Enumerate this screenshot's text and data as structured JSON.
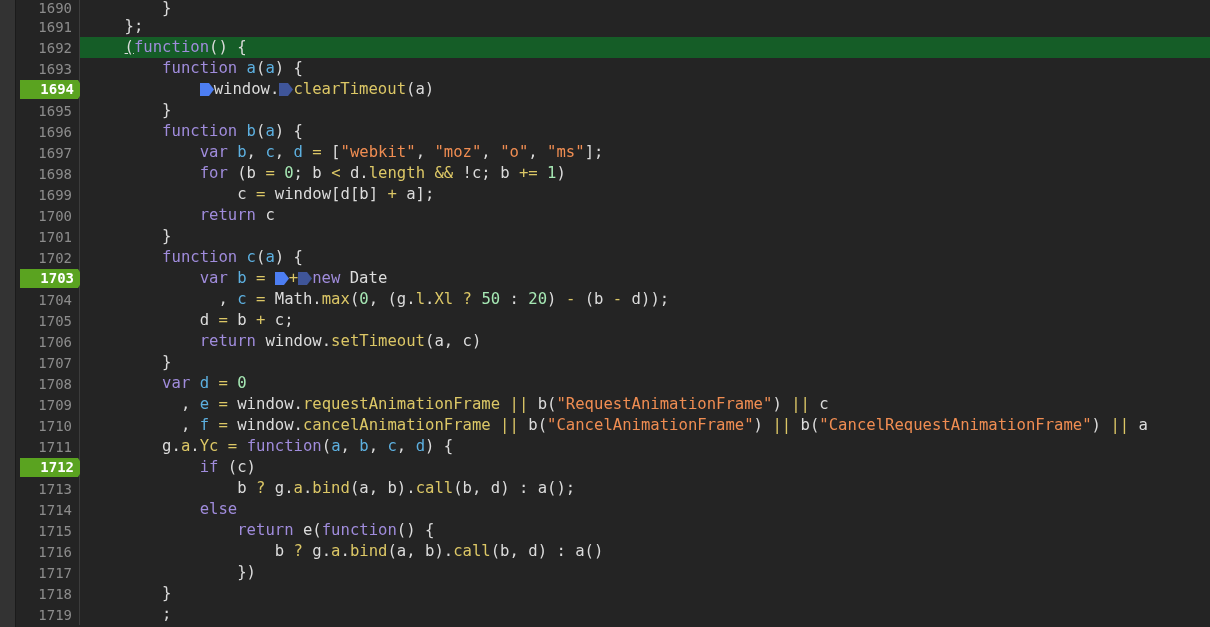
{
  "editor": {
    "lines": [
      {
        "number": "1690",
        "breakpoint": false,
        "current": false,
        "tokens": [
          {
            "text": "        }",
            "kind": "text"
          }
        ]
      },
      {
        "number": "1691",
        "breakpoint": false,
        "current": false,
        "tokens": [
          {
            "text": "    };",
            "kind": "text"
          }
        ]
      },
      {
        "number": "1692",
        "breakpoint": false,
        "current": true,
        "tokens": [
          {
            "text": "    (",
            "kind": "cursor"
          },
          {
            "text": "function",
            "kind": "keyword"
          },
          {
            "text": "() {",
            "kind": "text"
          }
        ]
      },
      {
        "number": "1693",
        "breakpoint": false,
        "current": false,
        "tokens": [
          {
            "text": "        function ",
            "kind": "keyword"
          },
          {
            "text": "a",
            "kind": "param"
          },
          {
            "text": "(",
            "kind": "text"
          },
          {
            "text": "a",
            "kind": "param"
          },
          {
            "text": ") {",
            "kind": "text"
          }
        ]
      },
      {
        "number": "1694",
        "breakpoint": true,
        "current": false,
        "tokens": [
          {
            "kind": "marker",
            "active": true
          },
          {
            "text": "window.",
            "kind": "text"
          },
          {
            "kind": "marker",
            "active": false
          },
          {
            "text": "clearTimeout",
            "kind": "member"
          },
          {
            "text": "(a)",
            "kind": "text"
          }
        ]
      },
      {
        "number": "1695",
        "breakpoint": false,
        "current": false,
        "tokens": [
          {
            "text": "        }",
            "kind": "text"
          }
        ]
      },
      {
        "number": "1696",
        "breakpoint": false,
        "current": false,
        "tokens": [
          {
            "text": "        function ",
            "kind": "keyword"
          },
          {
            "text": "b",
            "kind": "param"
          },
          {
            "text": "(",
            "kind": "text"
          },
          {
            "text": "a",
            "kind": "param"
          },
          {
            "text": ") {",
            "kind": "text"
          }
        ]
      },
      {
        "number": "1697",
        "breakpoint": false,
        "current": false,
        "tokens": [
          {
            "text": "            var ",
            "kind": "keyword"
          },
          {
            "text": "b",
            "kind": "param"
          },
          {
            "text": ", ",
            "kind": "text"
          },
          {
            "text": "c",
            "kind": "param"
          },
          {
            "text": ", ",
            "kind": "text"
          },
          {
            "text": "d ",
            "kind": "param"
          },
          {
            "text": "=",
            "kind": "operator"
          },
          {
            "text": " [",
            "kind": "text"
          },
          {
            "text": "\"webkit\"",
            "kind": "string"
          },
          {
            "text": ", ",
            "kind": "text"
          },
          {
            "text": "\"moz\"",
            "kind": "string"
          },
          {
            "text": ", ",
            "kind": "text"
          },
          {
            "text": "\"o\"",
            "kind": "string"
          },
          {
            "text": ", ",
            "kind": "text"
          },
          {
            "text": "\"ms\"",
            "kind": "string"
          },
          {
            "text": "];",
            "kind": "text"
          }
        ]
      },
      {
        "number": "1698",
        "breakpoint": false,
        "current": false,
        "tokens": [
          {
            "text": "            for",
            "kind": "keyword"
          },
          {
            "text": " (b ",
            "kind": "text"
          },
          {
            "text": "= ",
            "kind": "operator"
          },
          {
            "text": "0",
            "kind": "number"
          },
          {
            "text": "; b ",
            "kind": "text"
          },
          {
            "text": "<",
            "kind": "operator"
          },
          {
            "text": " d.",
            "kind": "text"
          },
          {
            "text": "length ",
            "kind": "member"
          },
          {
            "text": "&&",
            "kind": "operator"
          },
          {
            "text": " !c; b ",
            "kind": "text"
          },
          {
            "text": "+= ",
            "kind": "operator"
          },
          {
            "text": "1",
            "kind": "number"
          },
          {
            "text": ")",
            "kind": "text"
          }
        ]
      },
      {
        "number": "1699",
        "breakpoint": false,
        "current": false,
        "tokens": [
          {
            "text": "                c ",
            "kind": "text"
          },
          {
            "text": "=",
            "kind": "operator"
          },
          {
            "text": " window[d[b] ",
            "kind": "text"
          },
          {
            "text": "+",
            "kind": "operator"
          },
          {
            "text": " a];",
            "kind": "text"
          }
        ]
      },
      {
        "number": "1700",
        "breakpoint": false,
        "current": false,
        "tokens": [
          {
            "text": "            return",
            "kind": "keyword"
          },
          {
            "text": " c",
            "kind": "text"
          }
        ]
      },
      {
        "number": "1701",
        "breakpoint": false,
        "current": false,
        "tokens": [
          {
            "text": "        }",
            "kind": "text"
          }
        ]
      },
      {
        "number": "1702",
        "breakpoint": false,
        "current": false,
        "tokens": [
          {
            "text": "        function ",
            "kind": "keyword"
          },
          {
            "text": "c",
            "kind": "param"
          },
          {
            "text": "(",
            "kind": "text"
          },
          {
            "text": "a",
            "kind": "param"
          },
          {
            "text": ") {",
            "kind": "text"
          }
        ]
      },
      {
        "number": "1703",
        "breakpoint": true,
        "current": false,
        "tokens": [
          {
            "text": "            var ",
            "kind": "keyword"
          },
          {
            "text": "b ",
            "kind": "param"
          },
          {
            "text": "= ",
            "kind": "operator"
          },
          {
            "kind": "marker",
            "active": true
          },
          {
            "text": "+",
            "kind": "operator"
          },
          {
            "kind": "marker",
            "active": false
          },
          {
            "text": "new",
            "kind": "keyword"
          },
          {
            "text": " Date",
            "kind": "text"
          }
        ]
      },
      {
        "number": "1704",
        "breakpoint": false,
        "current": false,
        "tokens": [
          {
            "text": "              , ",
            "kind": "text"
          },
          {
            "text": "c ",
            "kind": "param"
          },
          {
            "text": "=",
            "kind": "operator"
          },
          {
            "text": " Math.",
            "kind": "text"
          },
          {
            "text": "max",
            "kind": "member"
          },
          {
            "text": "(",
            "kind": "text"
          },
          {
            "text": "0",
            "kind": "number"
          },
          {
            "text": ", (g.",
            "kind": "text"
          },
          {
            "text": "l",
            "kind": "member"
          },
          {
            "text": ".",
            "kind": "text"
          },
          {
            "text": "Xl ",
            "kind": "member"
          },
          {
            "text": "? ",
            "kind": "operator"
          },
          {
            "text": "50",
            "kind": "number"
          },
          {
            "text": " : ",
            "kind": "text"
          },
          {
            "text": "20",
            "kind": "number"
          },
          {
            "text": ") ",
            "kind": "text"
          },
          {
            "text": "-",
            "kind": "operator"
          },
          {
            "text": " (b ",
            "kind": "text"
          },
          {
            "text": "-",
            "kind": "operator"
          },
          {
            "text": " d));",
            "kind": "text"
          }
        ]
      },
      {
        "number": "1705",
        "breakpoint": false,
        "current": false,
        "tokens": [
          {
            "text": "            d ",
            "kind": "text"
          },
          {
            "text": "=",
            "kind": "operator"
          },
          {
            "text": " b ",
            "kind": "text"
          },
          {
            "text": "+",
            "kind": "operator"
          },
          {
            "text": " c;",
            "kind": "text"
          }
        ]
      },
      {
        "number": "1706",
        "breakpoint": false,
        "current": false,
        "tokens": [
          {
            "text": "            return",
            "kind": "keyword"
          },
          {
            "text": " window.",
            "kind": "text"
          },
          {
            "text": "setTimeout",
            "kind": "member"
          },
          {
            "text": "(a, c)",
            "kind": "text"
          }
        ]
      },
      {
        "number": "1707",
        "breakpoint": false,
        "current": false,
        "tokens": [
          {
            "text": "        }",
            "kind": "text"
          }
        ]
      },
      {
        "number": "1708",
        "breakpoint": false,
        "current": false,
        "tokens": [
          {
            "text": "        var ",
            "kind": "keyword"
          },
          {
            "text": "d ",
            "kind": "param"
          },
          {
            "text": "= ",
            "kind": "operator"
          },
          {
            "text": "0",
            "kind": "number"
          }
        ]
      },
      {
        "number": "1709",
        "breakpoint": false,
        "current": false,
        "tokens": [
          {
            "text": "          , ",
            "kind": "text"
          },
          {
            "text": "e ",
            "kind": "param"
          },
          {
            "text": "=",
            "kind": "operator"
          },
          {
            "text": " window.",
            "kind": "text"
          },
          {
            "text": "requestAnimationFrame ",
            "kind": "member"
          },
          {
            "text": "||",
            "kind": "operator"
          },
          {
            "text": " b(",
            "kind": "text"
          },
          {
            "text": "\"RequestAnimationFrame\"",
            "kind": "string"
          },
          {
            "text": ") ",
            "kind": "text"
          },
          {
            "text": "||",
            "kind": "operator"
          },
          {
            "text": " c",
            "kind": "text"
          }
        ]
      },
      {
        "number": "1710",
        "breakpoint": false,
        "current": false,
        "tokens": [
          {
            "text": "          , ",
            "kind": "text"
          },
          {
            "text": "f ",
            "kind": "param"
          },
          {
            "text": "=",
            "kind": "operator"
          },
          {
            "text": " window.",
            "kind": "text"
          },
          {
            "text": "cancelAnimationFrame ",
            "kind": "member"
          },
          {
            "text": "||",
            "kind": "operator"
          },
          {
            "text": " b(",
            "kind": "text"
          },
          {
            "text": "\"CancelAnimationFrame\"",
            "kind": "string"
          },
          {
            "text": ") ",
            "kind": "text"
          },
          {
            "text": "||",
            "kind": "operator"
          },
          {
            "text": " b(",
            "kind": "text"
          },
          {
            "text": "\"CancelRequestAnimationFrame\"",
            "kind": "string"
          },
          {
            "text": ") ",
            "kind": "text"
          },
          {
            "text": "||",
            "kind": "operator"
          },
          {
            "text": " a",
            "kind": "text"
          }
        ]
      },
      {
        "number": "1711",
        "breakpoint": false,
        "current": false,
        "tokens": [
          {
            "text": "        g.",
            "kind": "text"
          },
          {
            "text": "a",
            "kind": "member"
          },
          {
            "text": ".",
            "kind": "text"
          },
          {
            "text": "Yc ",
            "kind": "member"
          },
          {
            "text": "= ",
            "kind": "operator"
          },
          {
            "text": "function",
            "kind": "keyword"
          },
          {
            "text": "(",
            "kind": "text"
          },
          {
            "text": "a",
            "kind": "param"
          },
          {
            "text": ", ",
            "kind": "text"
          },
          {
            "text": "b",
            "kind": "param"
          },
          {
            "text": ", ",
            "kind": "text"
          },
          {
            "text": "c",
            "kind": "param"
          },
          {
            "text": ", ",
            "kind": "text"
          },
          {
            "text": "d",
            "kind": "param"
          },
          {
            "text": ") {",
            "kind": "text"
          }
        ]
      },
      {
        "number": "1712",
        "breakpoint": true,
        "current": false,
        "tokens": [
          {
            "text": "            if",
            "kind": "keyword"
          },
          {
            "text": " (c)",
            "kind": "text"
          }
        ]
      },
      {
        "number": "1713",
        "breakpoint": false,
        "current": false,
        "tokens": [
          {
            "text": "                b ",
            "kind": "text"
          },
          {
            "text": "?",
            "kind": "operator"
          },
          {
            "text": " g.",
            "kind": "text"
          },
          {
            "text": "a",
            "kind": "member"
          },
          {
            "text": ".",
            "kind": "text"
          },
          {
            "text": "bind",
            "kind": "member"
          },
          {
            "text": "(a, b).",
            "kind": "text"
          },
          {
            "text": "call",
            "kind": "member"
          },
          {
            "text": "(b, d) : a();",
            "kind": "text"
          }
        ]
      },
      {
        "number": "1714",
        "breakpoint": false,
        "current": false,
        "tokens": [
          {
            "text": "            else",
            "kind": "keyword"
          }
        ]
      },
      {
        "number": "1715",
        "breakpoint": false,
        "current": false,
        "tokens": [
          {
            "text": "                return",
            "kind": "keyword"
          },
          {
            "text": " e(",
            "kind": "text"
          },
          {
            "text": "function",
            "kind": "keyword"
          },
          {
            "text": "() {",
            "kind": "text"
          }
        ]
      },
      {
        "number": "1716",
        "breakpoint": false,
        "current": false,
        "tokens": [
          {
            "text": "                    b ",
            "kind": "text"
          },
          {
            "text": "?",
            "kind": "operator"
          },
          {
            "text": " g.",
            "kind": "text"
          },
          {
            "text": "a",
            "kind": "member"
          },
          {
            "text": ".",
            "kind": "text"
          },
          {
            "text": "bind",
            "kind": "member"
          },
          {
            "text": "(a, b).",
            "kind": "text"
          },
          {
            "text": "call",
            "kind": "member"
          },
          {
            "text": "(b, d) : a()",
            "kind": "text"
          }
        ]
      },
      {
        "number": "1717",
        "breakpoint": false,
        "current": false,
        "tokens": [
          {
            "text": "                })",
            "kind": "text"
          }
        ]
      },
      {
        "number": "1718",
        "breakpoint": false,
        "current": false,
        "tokens": [
          {
            "text": "        }",
            "kind": "text"
          }
        ]
      },
      {
        "number": "1719",
        "breakpoint": false,
        "current": false,
        "tokens": [
          {
            "text": "        ;",
            "kind": "text"
          }
        ]
      }
    ]
  }
}
